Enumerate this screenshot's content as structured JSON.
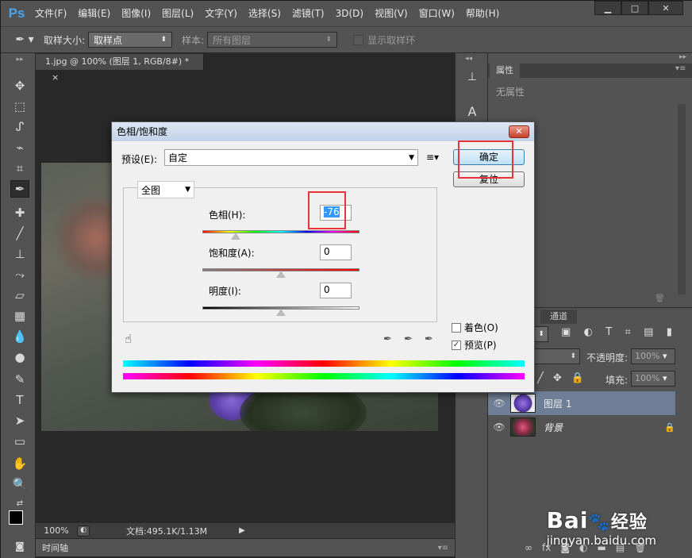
{
  "app": {
    "logo": "Ps"
  },
  "menu": [
    "文件(F)",
    "编辑(E)",
    "图像(I)",
    "图层(L)",
    "文字(Y)",
    "选择(S)",
    "滤镜(T)",
    "3D(D)",
    "视图(V)",
    "窗口(W)",
    "帮助(H)"
  ],
  "options": {
    "sample_size_label": "取样大小:",
    "sample_size_value": "取样点",
    "sample_label": "样本:",
    "sample_value": "所有图层",
    "ring_label": "显示取样环"
  },
  "document": {
    "tab_title": "1.jpg @ 100% (图层 1, RGB/8#) *",
    "tab_close": "×",
    "zoom": "100%",
    "doc_info": "文档:495.1K/1.13M"
  },
  "timeline": {
    "label": "时间轴"
  },
  "properties": {
    "tab": "属性",
    "content": "无属性"
  },
  "layers": {
    "tab": "通道",
    "opacity_label": "不透明度:",
    "opacity_value": "100%",
    "fill_label": "填充:",
    "fill_value": "100%",
    "items": [
      {
        "name": "图层 1"
      },
      {
        "name": "背景"
      }
    ]
  },
  "dialog": {
    "title": "色相/饱和度",
    "preset_label": "预设(E):",
    "preset_value": "自定",
    "ok": "确定",
    "reset": "复位",
    "channel": "全图",
    "hue_label": "色相(H):",
    "hue_value": "-76",
    "saturation_label": "饱和度(A):",
    "saturation_value": "0",
    "lightness_label": "明度(I):",
    "lightness_value": "0",
    "colorize_label": "着色(O)",
    "preview_label": "预览(P)",
    "preview_checked": true,
    "colorize_checked": false
  },
  "watermark": {
    "brand": "Bai",
    "brand2": "经验",
    "url": "jingyan.baidu.com"
  }
}
